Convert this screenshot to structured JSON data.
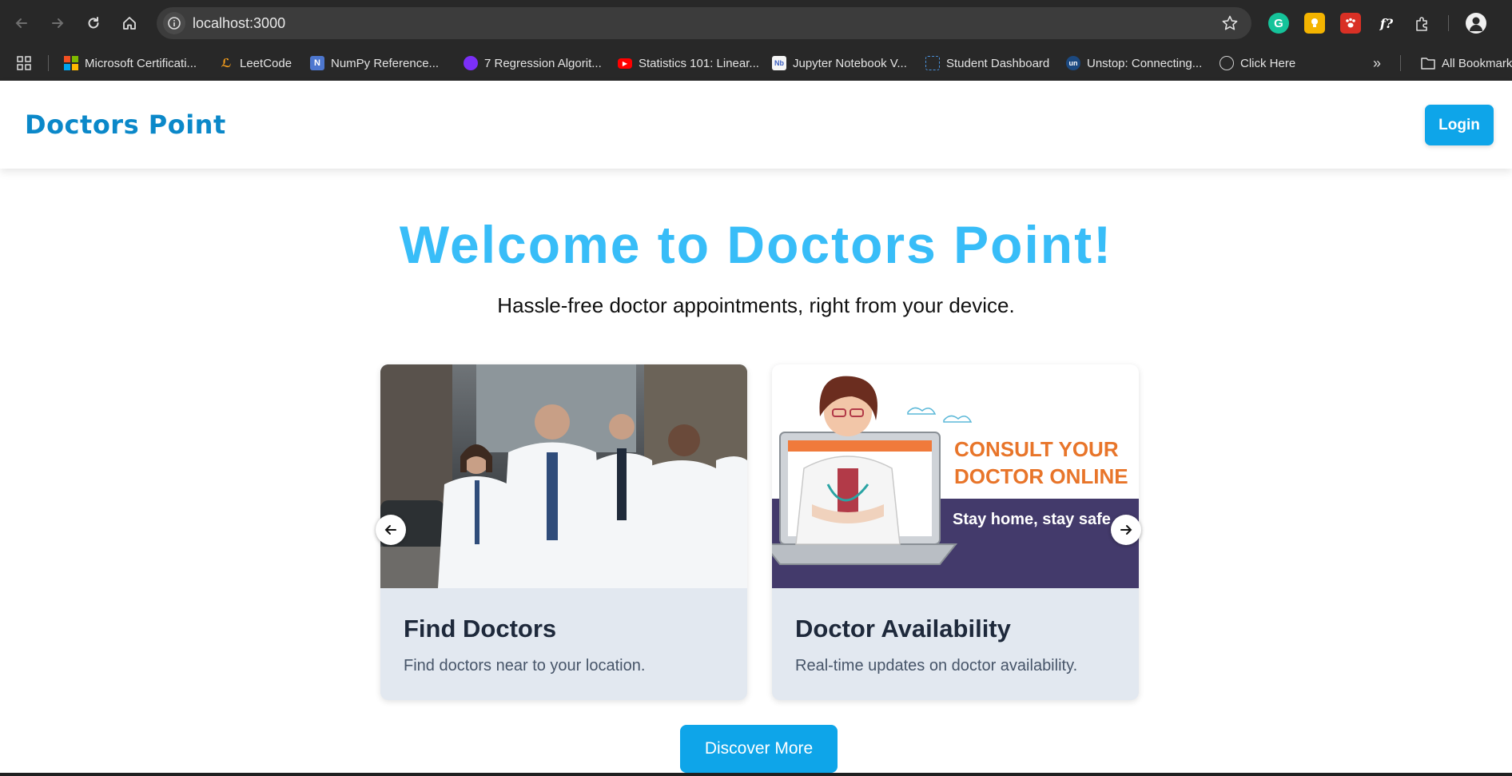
{
  "browser": {
    "url": "localhost:3000",
    "bookmarks": [
      {
        "label": "Microsoft Certificati...",
        "icon": "microsoft-icon"
      },
      {
        "label": "LeetCode",
        "icon": "leetcode-icon"
      },
      {
        "label": "NumPy Reference...",
        "icon": "numpy-icon"
      },
      {
        "label": "7 Regression Algorit...",
        "icon": "purple-globe-icon"
      },
      {
        "label": "Statistics 101: Linear...",
        "icon": "youtube-icon"
      },
      {
        "label": "Jupyter Notebook V...",
        "icon": "nb-icon"
      },
      {
        "label": "Student Dashboard",
        "icon": "dashboard-icon"
      },
      {
        "label": "Unstop: Connecting...",
        "icon": "unstop-icon"
      },
      {
        "label": "Click Here",
        "icon": "globe-icon"
      }
    ],
    "all_bookmarks": "All Bookmarks",
    "ext_f_label": "f?"
  },
  "header": {
    "brand": "Doctors Point",
    "login_label": "Login"
  },
  "hero": {
    "title": "Welcome to Doctors Point!",
    "subtitle": "Hassle-free doctor appointments, right from your device."
  },
  "cards": [
    {
      "title": "Find Doctors",
      "description": "Find doctors near to your location."
    },
    {
      "title": "Doctor Availability",
      "description": "Real-time updates on doctor availability.",
      "banner_line1": "CONSULT YOUR",
      "banner_line2": "DOCTOR ONLINE",
      "banner_line3": "Stay home, stay safe"
    }
  ],
  "cta": {
    "discover_label": "Discover More"
  },
  "colors": {
    "accent": "#0ea5e9",
    "title": "#38bdf8",
    "brand": "#0b88c9",
    "card_bg": "#e2e8f0"
  }
}
